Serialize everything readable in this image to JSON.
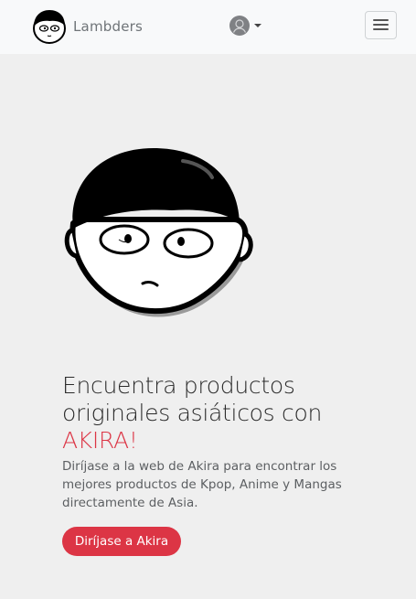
{
  "navbar": {
    "brand_name": "Lambders",
    "brand_logo_icon": "cartoon-face-logo-icon",
    "user_icon": "user-avatar-icon",
    "menu_icon": "hamburger-menu-icon"
  },
  "hero": {
    "illustration_icon": "cartoon-boy-face-icon",
    "headline_main": "Encuentra productos originales asiáticos con ",
    "headline_accent": "AKIRA!",
    "lead": "Diríjase a la web de Akira para encontrar los mejores productos de Kpop, Anime y Mangas directamente de Asia.",
    "cta_label": "Diríjase a Akira"
  },
  "colors": {
    "accent": "#dc3545",
    "navbar_bg": "#f8f9fa",
    "page_bg": "#efefef",
    "text_dark": "#2b2b2b",
    "text_muted": "#5c5f62"
  }
}
